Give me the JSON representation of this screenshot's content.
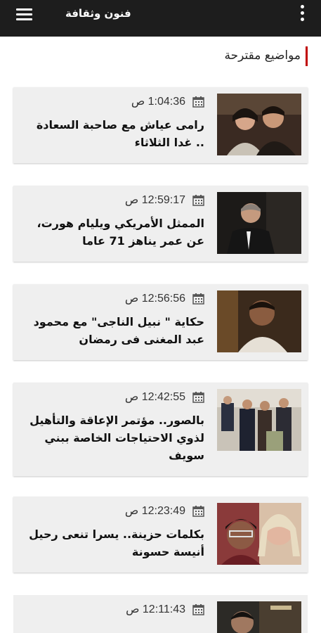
{
  "header": {
    "title": "فنون وثقافة",
    "menu_icon": "hamburger-menu-icon",
    "more_icon": "vertical-dots-icon",
    "background_color": "#1d1d1d"
  },
  "section": {
    "title": "مواضيع مقترحة",
    "accent_color": "#c00000"
  },
  "articles": [
    {
      "time": "1:04:36 ص",
      "title": "رامى عياش مع صاحبة السعادة .. غدا الثلاثاء"
    },
    {
      "time": "12:59:17 ص",
      "title": "الممثل الأمريكي ويليام هورت، عن عمر يناهز 71 عاما"
    },
    {
      "time": "12:56:56 ص",
      "title": "حكاية \" نبيل الناجى\" مع محمود عبد المغنى فى رمضان"
    },
    {
      "time": "12:42:55 ص",
      "title": "بالصور.. مؤتمر الإعاقة والتأهيل لذوي الاحتياجات الخاصة ببني سويف"
    },
    {
      "time": "12:23:49 ص",
      "title": "بكلمات حزينة.. يسرا تنعى رحيل أنيسة حسونة"
    },
    {
      "time": "12:11:43 ص",
      "title": ""
    }
  ]
}
